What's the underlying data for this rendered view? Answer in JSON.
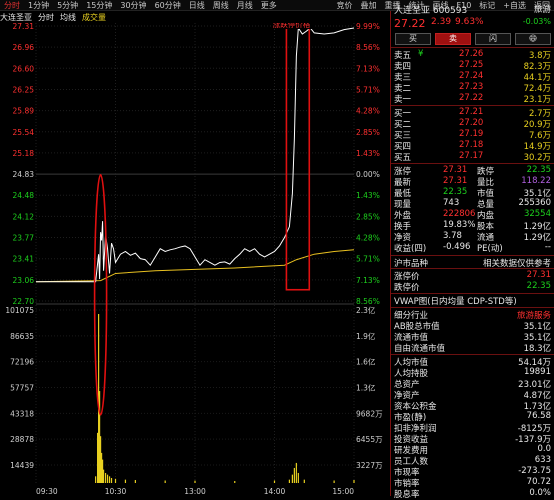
{
  "toolbar": {
    "tabs": [
      "分时",
      "1分钟",
      "5分钟",
      "15分钟",
      "30分钟",
      "60分钟",
      "日线",
      "周线",
      "月线",
      "更多"
    ],
    "active_tab": "分时",
    "right_tools": [
      "竞价",
      "叠加",
      "重播",
      "统计",
      "画线",
      "F10",
      "标记",
      "+自选",
      "返回"
    ]
  },
  "chart_header": {
    "name": "大连圣亚",
    "mode": "分时",
    "legend_avg": "均线",
    "legend_vol": "成交量",
    "badge": "涨跌停价格"
  },
  "price_axis": {
    "left": [
      "27.31",
      "26.96",
      "26.60",
      "26.25",
      "25.89",
      "25.54",
      "25.18",
      "24.83",
      "24.48",
      "24.12",
      "23.77",
      "23.41",
      "23.06",
      "22.70"
    ],
    "right": [
      "9.99%",
      "8.56%",
      "7.13%",
      "5.71%",
      "4.28%",
      "2.85%",
      "1.43%",
      "0.00%",
      "1.43%",
      "2.85%",
      "4.28%",
      "5.71%",
      "7.13%",
      "8.56%"
    ]
  },
  "volume_axis": {
    "left": [
      "101075",
      "86635",
      "72196",
      "57757",
      "43318",
      "28878",
      "14439"
    ],
    "right": [
      "2.3亿",
      "1.9亿",
      "1.6亿",
      "1.3亿",
      "9682万",
      "6455万",
      "3227万"
    ]
  },
  "time_axis": [
    "09:30",
    "10:30",
    "13:00",
    "14:00",
    "15:00"
  ],
  "chart_data": {
    "type": "line",
    "prev_close": 24.83,
    "ylim": [
      22.35,
      27.4
    ],
    "price": [
      [
        0,
        22.7
      ],
      [
        60,
        22.7
      ],
      [
        63,
        23.2
      ],
      [
        64,
        22.75
      ],
      [
        65,
        23.6
      ],
      [
        66,
        23.45
      ],
      [
        67,
        23.8
      ],
      [
        68,
        22.9
      ],
      [
        70,
        23.55
      ],
      [
        72,
        23.3
      ],
      [
        74,
        22.85
      ],
      [
        76,
        23.4
      ],
      [
        78,
        23.3
      ],
      [
        80,
        23.05
      ],
      [
        85,
        23.2
      ],
      [
        90,
        23.25
      ],
      [
        95,
        23.18
      ],
      [
        100,
        23.22
      ],
      [
        105,
        23.12
      ],
      [
        110,
        23.1
      ],
      [
        115,
        23.0
      ],
      [
        120,
        23.15
      ],
      [
        125,
        23.3
      ],
      [
        130,
        23.25
      ],
      [
        135,
        23.28
      ],
      [
        140,
        23.3
      ],
      [
        145,
        23.33
      ],
      [
        150,
        23.35
      ],
      [
        155,
        23.3
      ],
      [
        160,
        23.15
      ],
      [
        165,
        23.0
      ],
      [
        170,
        23.1
      ],
      [
        175,
        23.05
      ],
      [
        180,
        23.0
      ],
      [
        185,
        23.05
      ],
      [
        190,
        23.06
      ],
      [
        195,
        23.02
      ],
      [
        200,
        23.12
      ],
      [
        205,
        23.2
      ],
      [
        210,
        23.3
      ],
      [
        215,
        23.25
      ],
      [
        220,
        23.3
      ],
      [
        225,
        23.2
      ],
      [
        230,
        23.15
      ],
      [
        235,
        23.2
      ],
      [
        240,
        23.25
      ],
      [
        245,
        23.35
      ],
      [
        250,
        23.5
      ],
      [
        255,
        23.7
      ],
      [
        258,
        24.3
      ],
      [
        260,
        25.3
      ],
      [
        262,
        26.8
      ],
      [
        264,
        27.31
      ],
      [
        268,
        27.2
      ],
      [
        272,
        27.25
      ],
      [
        276,
        27.31
      ],
      [
        280,
        27.22
      ],
      [
        290,
        27.2
      ],
      [
        300,
        27.22
      ],
      [
        310,
        27.28
      ],
      [
        320,
        27.31
      ]
    ],
    "avg": [
      [
        0,
        22.7
      ],
      [
        65,
        22.72
      ],
      [
        80,
        22.85
      ],
      [
        120,
        22.9
      ],
      [
        200,
        22.95
      ],
      [
        250,
        23.0
      ],
      [
        262,
        23.1
      ],
      [
        280,
        23.2
      ],
      [
        300,
        23.25
      ],
      [
        320,
        23.28
      ]
    ],
    "volume": [
      [
        60,
        4000
      ],
      [
        62,
        30000
      ],
      [
        63,
        101075
      ],
      [
        64,
        55000
      ],
      [
        65,
        28000
      ],
      [
        66,
        18000
      ],
      [
        67,
        14000
      ],
      [
        68,
        8000
      ],
      [
        70,
        6000
      ],
      [
        72,
        5000
      ],
      [
        74,
        4000
      ],
      [
        76,
        3000
      ],
      [
        80,
        2500
      ],
      [
        90,
        2000
      ],
      [
        100,
        1800
      ],
      [
        130,
        1500
      ],
      [
        160,
        1400
      ],
      [
        200,
        1200
      ],
      [
        240,
        1500
      ],
      [
        255,
        2000
      ],
      [
        258,
        5000
      ],
      [
        260,
        9000
      ],
      [
        262,
        12000
      ],
      [
        264,
        6000
      ],
      [
        270,
        2000
      ],
      [
        300,
        1500
      ],
      [
        320,
        1800
      ]
    ],
    "vol_max": 101075,
    "highlight_boxes": [
      "early-spike-ellipse",
      "afternoon-surge-rect"
    ]
  },
  "quote": {
    "name": "大连圣亚",
    "code": "600593",
    "tag": "旅游",
    "price": "27.22",
    "change": "2.39",
    "pct": "9.63%",
    "speed": "-0.03%",
    "buttons": [
      "买",
      "卖",
      "闪",
      "😄"
    ],
    "asks": [
      {
        "label": "卖五",
        "flag": "¥",
        "price": "27.26",
        "vol": "3.8万"
      },
      {
        "label": "卖四",
        "flag": "",
        "price": "27.25",
        "vol": "82.3万"
      },
      {
        "label": "卖三",
        "flag": "",
        "price": "27.24",
        "vol": "44.1万"
      },
      {
        "label": "卖二",
        "flag": "",
        "price": "27.23",
        "vol": "72.4万"
      },
      {
        "label": "卖一",
        "flag": "",
        "price": "27.22",
        "vol": "23.1万"
      }
    ],
    "bids": [
      {
        "label": "买一",
        "price": "27.21",
        "vol": "2.7万"
      },
      {
        "label": "买二",
        "price": "27.20",
        "vol": "20.9万"
      },
      {
        "label": "买三",
        "price": "27.19",
        "vol": "7.6万"
      },
      {
        "label": "买四",
        "price": "27.18",
        "vol": "14.9万"
      },
      {
        "label": "买五",
        "price": "27.17",
        "vol": "30.2万"
      }
    ],
    "stats": [
      {
        "l1": "涨停",
        "v1": "27.31",
        "c1": "red",
        "l2": "跌停",
        "v2": "22.35",
        "c2": "green"
      },
      {
        "l1": "最新",
        "v1": "27.31",
        "c1": "red",
        "l2": "量比",
        "v2": "118.22",
        "c2": "purple"
      },
      {
        "l1": "最低",
        "v1": "22.35",
        "c1": "green",
        "l2": "市值",
        "v2": "35.1亿",
        "c2": "white"
      },
      {
        "l1": "现量",
        "v1": "743",
        "c1": "white",
        "l2": "总量",
        "v2": "255360",
        "c2": "white"
      },
      {
        "l1": "外盘",
        "v1": "222806",
        "c1": "red",
        "l2": "内盘",
        "v2": "32554",
        "c2": "green"
      },
      {
        "l1": "换手",
        "v1": "19.83%",
        "c1": "white",
        "l2": "股本",
        "v2": "1.29亿",
        "c2": "white"
      },
      {
        "l1": "净资",
        "v1": "3.78",
        "c1": "white",
        "l2": "流通",
        "v2": "1.29亿",
        "c2": "white"
      },
      {
        "l1": "收益(四)",
        "v1": "-0.496",
        "c1": "white",
        "l2": "PE(动)",
        "v2": "--",
        "c2": "white"
      }
    ],
    "hk": {
      "title": "沪市品种",
      "note": "相关数据仅供参考"
    },
    "limits": [
      {
        "label": "涨停价",
        "value": "27.31"
      },
      {
        "label": "跌停价",
        "value": "22.35"
      }
    ],
    "vwap": "VWAP图(日内均量 CDP-STD等)",
    "industry": {
      "label": "细分行业",
      "value": "旅游服务"
    },
    "fundamentals": [
      {
        "label": "AB股总市值",
        "value": "35.1亿"
      },
      {
        "label": "流通市值",
        "value": "35.1亿"
      },
      {
        "label": "自由流通市值",
        "value": "18.3亿"
      },
      {
        "label": "人均市值",
        "value": "54.14万"
      },
      {
        "label": "人均持股",
        "value": "19891"
      },
      {
        "label": "总资产",
        "value": "23.01亿"
      },
      {
        "label": "净资产",
        "value": "4.87亿"
      },
      {
        "label": "资本公积金",
        "value": "1.73亿"
      },
      {
        "label": "市盈(静)",
        "value": "76.58"
      },
      {
        "label": "扣非净利润",
        "value": "-8125万"
      },
      {
        "label": "投资收益",
        "value": "-137.9万"
      },
      {
        "label": "研发费用",
        "value": "0.0"
      },
      {
        "label": "员工人数",
        "value": "633"
      },
      {
        "label": "市现率",
        "value": "-273.75"
      },
      {
        "label": "市销率",
        "value": "70.72"
      },
      {
        "label": "股息率",
        "value": "0.0%"
      }
    ]
  },
  "colors": {
    "up": "#ff3030",
    "down": "#1dd01d",
    "avg": "#e8c020",
    "price": "#ffffff",
    "highlight": "#e01010"
  }
}
